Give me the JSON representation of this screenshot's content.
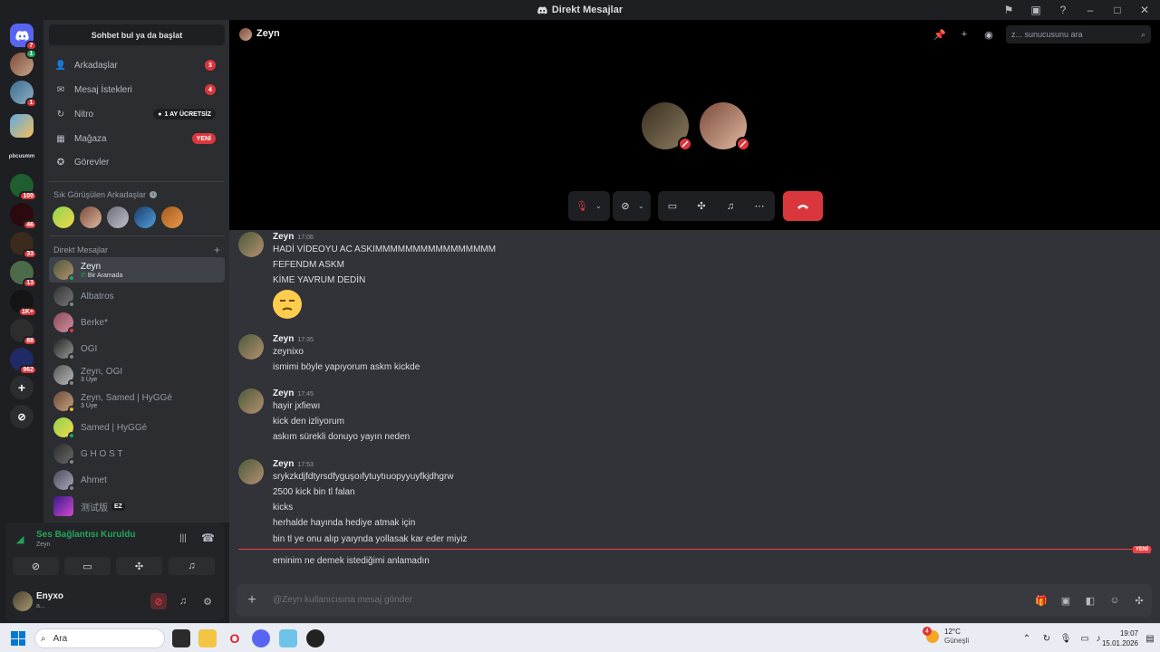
{
  "window": {
    "title": "Direkt Mesajlar"
  },
  "servers": [
    {
      "badge": "7"
    },
    {
      "badge": "1"
    },
    {
      "badge": "1"
    },
    {
      "badge": ""
    },
    {
      "label": "ρbcusmm"
    },
    {
      "badge": "100"
    },
    {
      "badge": "46"
    },
    {
      "badge": "33"
    },
    {
      "badge": "13"
    },
    {
      "badge": "1K+"
    },
    {
      "badge": "88"
    },
    {
      "badge": "962"
    }
  ],
  "sidebar": {
    "search_label": "Sohbet bul ya da başlat",
    "nav": [
      {
        "label": "Arkadaşlar",
        "badge": "3"
      },
      {
        "label": "Mesaj İstekleri",
        "badge": "4"
      },
      {
        "label": "Nitro",
        "pill": "1 AY ÜCRETSİZ"
      },
      {
        "label": "Mağaza",
        "pill": "YENİ"
      },
      {
        "label": "Görevler"
      }
    ],
    "frequent_title": "Sık Görüşülen Arkadaşlar",
    "dm_title": "Direkt Mesajlar",
    "dms": [
      {
        "name": "Zeyn",
        "sub": "Bir Aramada"
      },
      {
        "name": "Albatros",
        "sub": ""
      },
      {
        "name": "Berke*",
        "sub": ""
      },
      {
        "name": "OGI",
        "sub": ""
      },
      {
        "name": "Zeyn, OGI",
        "sub": "3 Üye"
      },
      {
        "name": "Zeyn, Samed | HyGGé",
        "sub": "3 Üye"
      },
      {
        "name": "Samed | HyGGé",
        "sub": ""
      },
      {
        "name": "G H O S T",
        "sub": ""
      },
      {
        "name": "Ahmet",
        "sub": ""
      },
      {
        "name": "测试版",
        "sub": "",
        "tag": "EZ"
      }
    ]
  },
  "voice": {
    "status": "Ses Bağlantısı Kuruldu",
    "channel": "Zeyn"
  },
  "user": {
    "name": "Enyxo",
    "status": "a..."
  },
  "header": {
    "name": "Zeyn",
    "search_placeholder": "z... sunucusunu ara"
  },
  "messages": [
    {
      "author": "Zeyn",
      "time": "17:06",
      "lines": [
        "HADİ VİDEOYU AC ASKIMMMMMMMMMMMMMMMM",
        "FEFENDM ASKM",
        "KİME YAVRUM DEDİN"
      ],
      "emoji": true
    },
    {
      "author": "Zeyn",
      "time": "17:35",
      "lines": [
        "zeynixo",
        "ismimi böyle yapıyorum askm kickde"
      ]
    },
    {
      "author": "Zeyn",
      "time": "17:45",
      "lines": [
        "hayir jxfiewı",
        "kick den izliyorum",
        "askım sürekli donuyo yayın neden"
      ]
    },
    {
      "author": "Zeyn",
      "time": "17:53",
      "lines": [
        "srykzkdjfdtyrsdfyguşoıfytuytıuopyyuyfkjdhgrw",
        "2500 kick bin tl falan",
        "kicks",
        "herhalde hayında hediye atmak için",
        "bin tl ye onu alıp yaıynda yollasak kar eder miyiz"
      ]
    }
  ],
  "new_message": "eminim ne demek istediğimi anlamadın",
  "new_badge": "YENİ",
  "composer": {
    "placeholder": "@Zeyn kullanıcısına mesaj gönder"
  },
  "taskbar": {
    "search": "Ara",
    "weather_temp": "12°C",
    "weather_desc": "Güneşli",
    "weather_badge": "4",
    "time": "19:07",
    "date": "15.01.2026"
  },
  "colors": {
    "accent": "#5865f2",
    "danger": "#da373c",
    "online": "#23a55a",
    "bg": "#313338"
  }
}
